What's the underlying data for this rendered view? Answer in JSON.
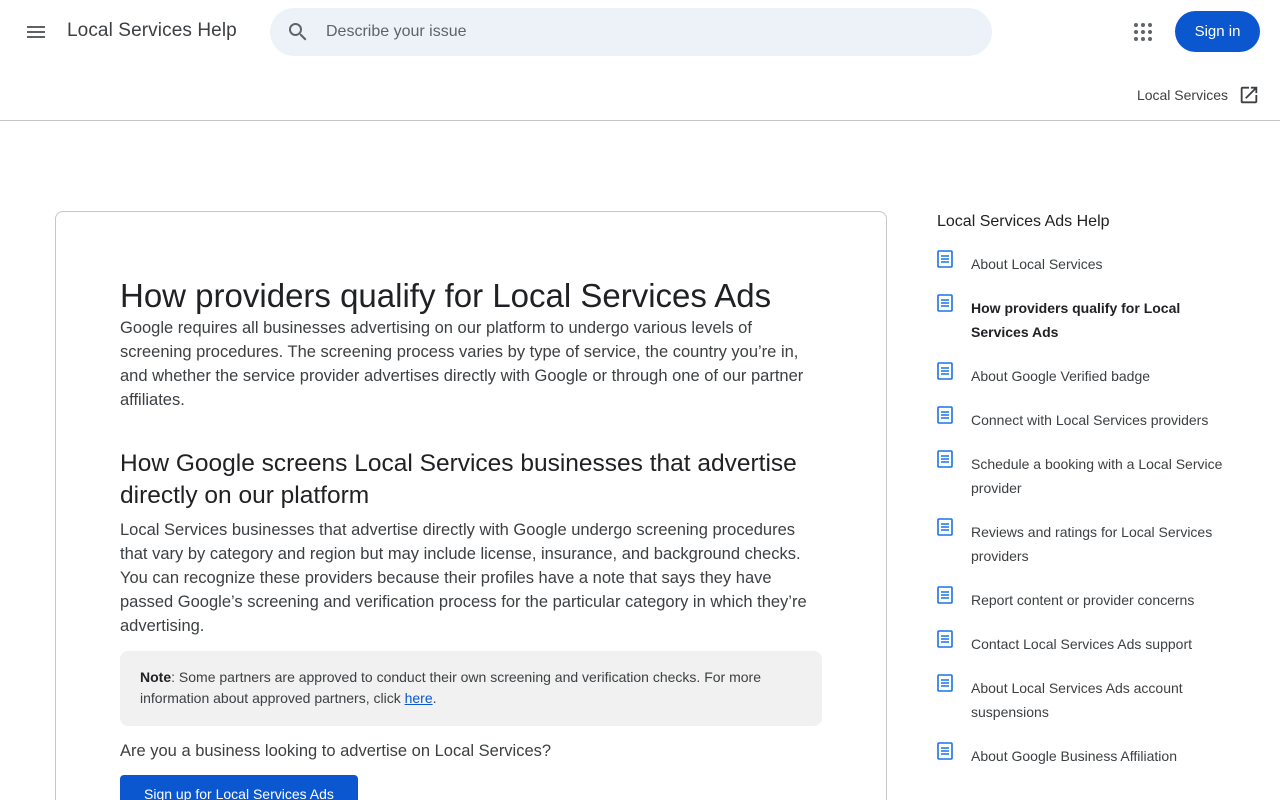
{
  "header": {
    "app_title": "Local Services Help",
    "search_placeholder": "Describe your issue",
    "signin_label": "Sign in"
  },
  "subbar": {
    "product_link_label": "Local Services"
  },
  "article": {
    "title": "How providers qualify for Local Services Ads",
    "intro": "Google requires all businesses advertising on our platform to undergo various levels of screening procedures. The screening process varies by type of service, the country you’re in, and whether the service provider advertises directly with Google or through one of our partner affiliates.",
    "section_title": "How Google screens Local Services businesses that advertise directly on our platform",
    "section_body": "Local Services businesses that advertise directly with Google undergo screening procedures that vary by category and region but may include license, insurance, and background checks. You can recognize these providers because their profiles have a note that says they have passed Google’s screening and verification process for the particular category in which they’re advertising.",
    "note_label": "Note",
    "note_text": ": Some partners are approved to conduct their own screening and verification checks. For more information about approved partners, click ",
    "note_link": "here",
    "note_end": ".",
    "cta_question": "Are you a business looking to advertise on Local Services?",
    "cta_button": "Sign up for Local Services Ads"
  },
  "sidebar": {
    "title": "Local Services Ads Help",
    "items": [
      {
        "label": "About Local Services",
        "active": false
      },
      {
        "label": "How providers qualify for Local Services Ads",
        "active": true
      },
      {
        "label": "About Google Verified badge",
        "active": false
      },
      {
        "label": "Connect with Local Services providers",
        "active": false
      },
      {
        "label": "Schedule a booking with a Local Service provider",
        "active": false
      },
      {
        "label": "Reviews and ratings for Local Services providers",
        "active": false
      },
      {
        "label": "Report content or provider concerns",
        "active": false
      },
      {
        "label": "Contact Local Services Ads support",
        "active": false
      },
      {
        "label": "About Local Services Ads account suspensions",
        "active": false
      },
      {
        "label": "About Google Business Affiliation",
        "active": false
      }
    ]
  },
  "colors": {
    "accent": "#0b57d0",
    "search_bg": "#edf2f8",
    "sidebar_icon": "#1a73e8"
  },
  "icons": {
    "menu": "menu-icon",
    "search": "search-icon",
    "apps": "apps-grid-icon",
    "external": "open-in-new-icon",
    "doc": "document-icon"
  }
}
